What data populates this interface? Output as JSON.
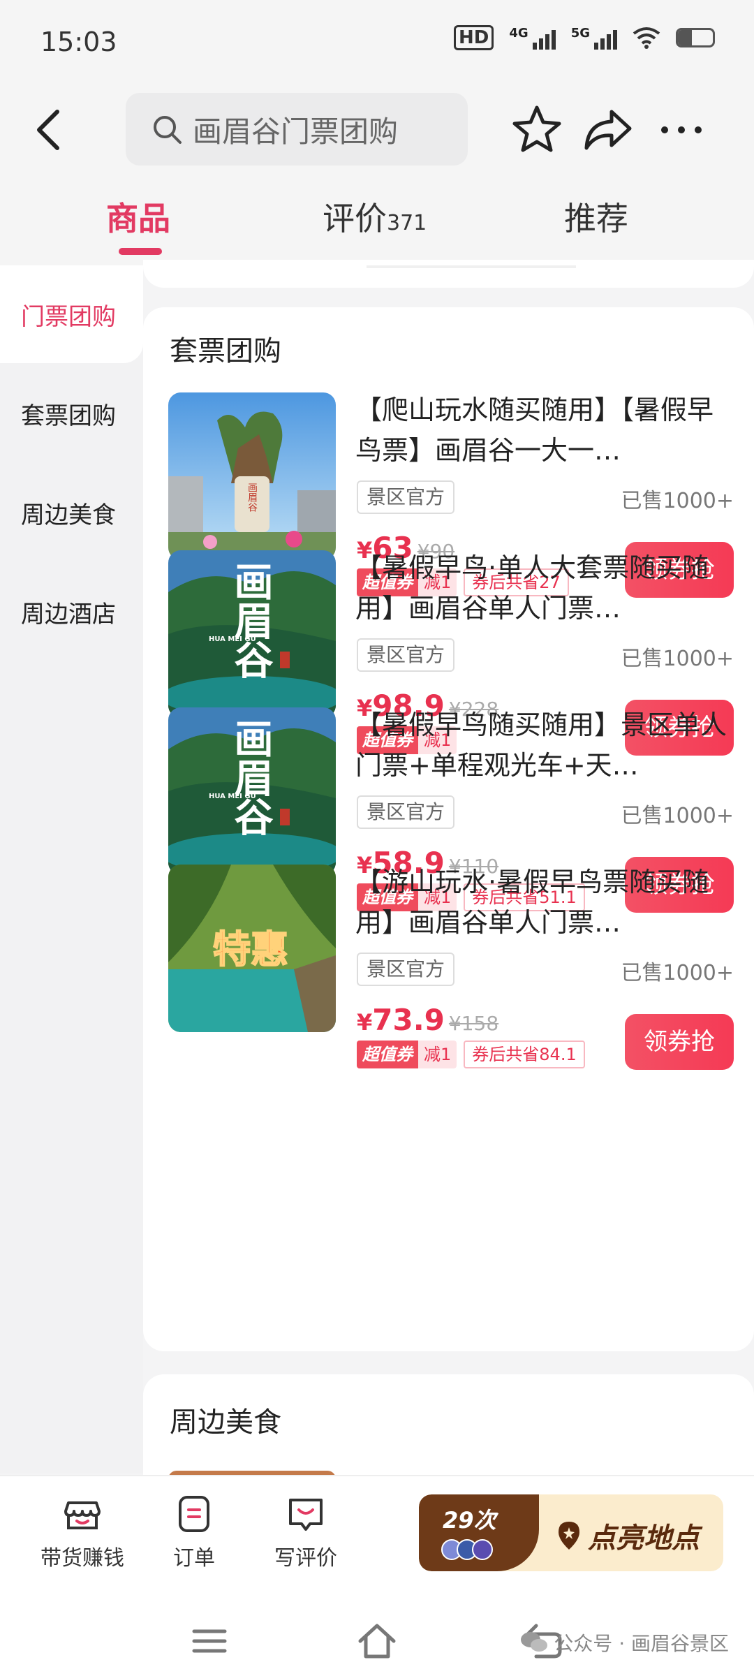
{
  "status": {
    "time": "15:03",
    "hd": "HD",
    "net1": "4G",
    "net2": "5G"
  },
  "header": {
    "search_placeholder": "画眉谷门票团购"
  },
  "tabs": [
    {
      "label": "商品"
    },
    {
      "label": "评价",
      "count": "371"
    },
    {
      "label": "推荐"
    }
  ],
  "sidebar": {
    "items": [
      {
        "label": "门票团购"
      },
      {
        "label": "套票团购"
      },
      {
        "label": "周边美食"
      },
      {
        "label": "周边酒店"
      }
    ]
  },
  "section": {
    "title": "套票团购"
  },
  "products": [
    {
      "title": "【爬山玩水随买随用】【暑假早鸟票】画眉谷一大一…",
      "official": "景区官方",
      "sold": "已售1000+",
      "currency": "¥",
      "price": "63",
      "orig": "¥90",
      "tag_label": "超值券",
      "tag_value": "减1",
      "save": "券后共省27",
      "buy": "领券抢"
    },
    {
      "title": "【暑假早鸟·单人大套票随买随用】画眉谷单人门票…",
      "official": "景区官方",
      "sold": "已售1000+",
      "currency": "¥",
      "price": "98.9",
      "orig": "¥228",
      "tag_label": "超值券",
      "tag_value": "减1",
      "save": "",
      "buy": "领券抢"
    },
    {
      "title": "【暑假早鸟随买随用】景区单人门票+单程观光车+天…",
      "official": "景区官方",
      "sold": "已售1000+",
      "currency": "¥",
      "price": "58.9",
      "orig": "¥110",
      "tag_label": "超值券",
      "tag_value": "减1",
      "save": "券后共省51.1",
      "buy": "领券抢"
    },
    {
      "title": "【游山玩水·暑假早鸟票随买随用】画眉谷单人门票…",
      "official": "景区官方",
      "sold": "已售1000+",
      "currency": "¥",
      "price": "73.9",
      "orig": "¥158",
      "tag_label": "超值券",
      "tag_value": "减1",
      "save": "券后共省84.1",
      "buy": "领券抢"
    }
  ],
  "product_image_text": {
    "brand": "画眉谷",
    "pinyin": "HUA MEI GU",
    "special": "特惠",
    "stone": "画眉谷"
  },
  "section2": {
    "title": "周边美食"
  },
  "bottombar": {
    "items": [
      {
        "label": "带货赚钱"
      },
      {
        "label": "订单"
      },
      {
        "label": "写评价"
      }
    ],
    "promo_count": "29次",
    "promo_label": "点亮地点"
  },
  "watermark": "公众号 · 画眉谷景区",
  "colors": {
    "accent": "#e23a62",
    "price": "#e8314f",
    "promo_bg": "#6e3a18"
  }
}
